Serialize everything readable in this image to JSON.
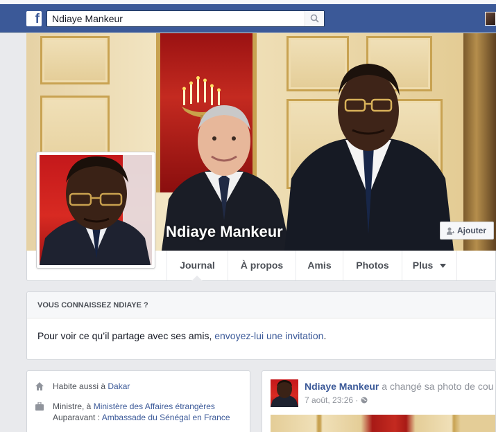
{
  "topbar": {
    "logo": "f",
    "search_value": "Ndiaye Mankeur",
    "search_icon": "search-icon"
  },
  "profile": {
    "name": "Ndiaye Mankeur",
    "add_friend_label": "Ajouter"
  },
  "tabs": [
    {
      "label": "Journal",
      "active": true
    },
    {
      "label": "À propos"
    },
    {
      "label": "Amis"
    },
    {
      "label": "Photos"
    },
    {
      "label": "Plus"
    }
  ],
  "know_card": {
    "title": "VOUS CONNAISSEZ NDIAYE ?",
    "text": "Pour voir ce qu’il partage avec ses amis,",
    "link": "envoyez-lui une invitation",
    "suffix": "."
  },
  "intro": {
    "lives": {
      "prefix": "Habite aussi à",
      "place": "Dakar"
    },
    "work": {
      "prefix": "Ministre, à",
      "employer": "Ministère des Affaires étrangères",
      "previous_prefix": "Auparavant :",
      "previous": "Ambassade du Sénégal en France"
    }
  },
  "post": {
    "author": "Ndiaye Mankeur",
    "action": "a changé sa photo de cou",
    "time": "7 août, 23:26 ·",
    "privacy_icon": "globe-icon"
  },
  "colors": {
    "brand": "#3b5998",
    "background": "#e9eaed"
  }
}
